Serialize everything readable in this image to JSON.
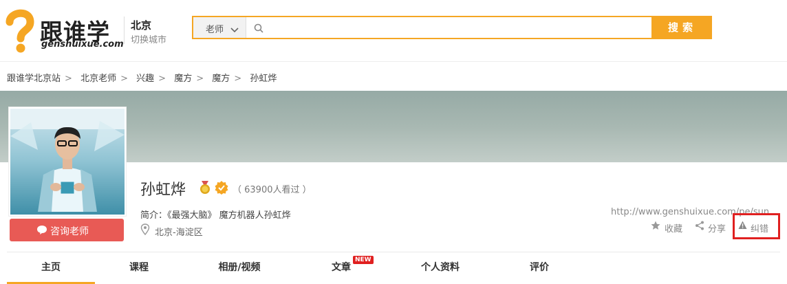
{
  "header": {
    "logo_text": "跟谁学",
    "logo_domain": "genshuixue.com",
    "city": "北京",
    "city_switch": "切换城市",
    "search": {
      "type_label": "老师",
      "placeholder": "",
      "button_label": "搜索"
    }
  },
  "breadcrumb": [
    "跟谁学北京站",
    "北京老师",
    "兴趣",
    "魔方",
    "魔方",
    "孙虹烨"
  ],
  "teacher": {
    "name": "孙虹烨",
    "views": "（ 63900人看过 ）",
    "intro": "简介：《最强大脑》 魔方机器人孙虹烨",
    "location": "北京-海淀区",
    "consult_label": "咨询老师",
    "url": "http://www.genshuixue.com/pe/sun"
  },
  "actions": {
    "favorite": "收藏",
    "share": "分享",
    "report": "纠错"
  },
  "tabs": [
    "主页",
    "课程",
    "相册/视频",
    "文章",
    "个人资料",
    "评价"
  ],
  "new_badge": "NEW",
  "colors": {
    "accent": "#f5a623",
    "consult": "#e85a55",
    "highlight": "#e02020"
  }
}
